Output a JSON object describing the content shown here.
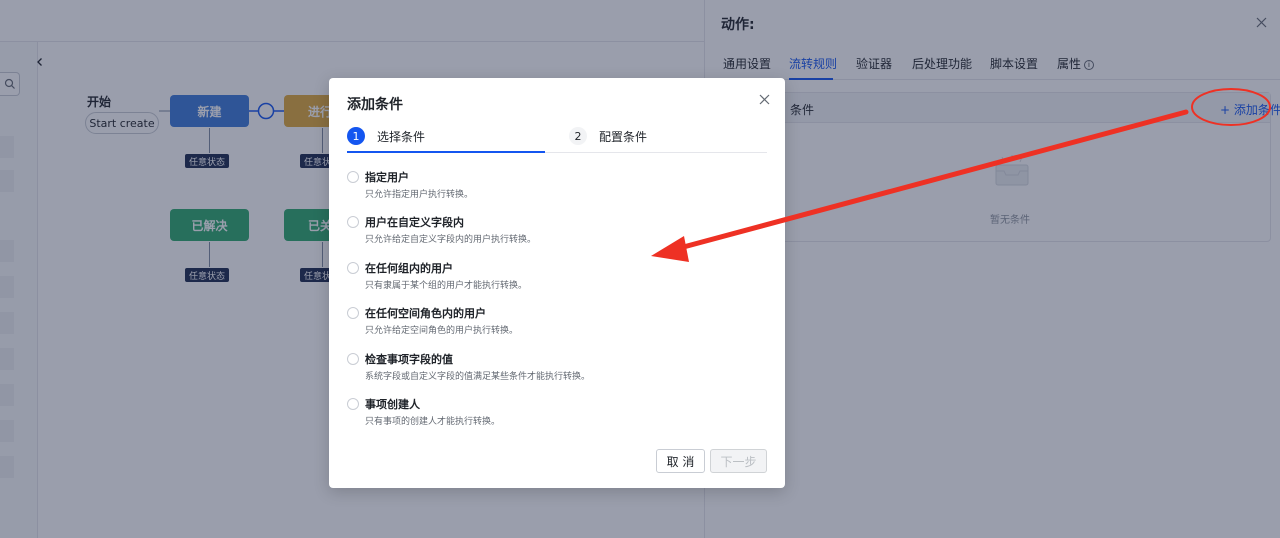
{
  "canvas": {
    "start_label": "开始",
    "start_pill": "Start create",
    "states": {
      "new": "新建",
      "in_progress": "进行",
      "resolved": "已解决",
      "closed": "已关"
    },
    "tags": {
      "any_state_1": "任意状态",
      "any_state_2": "任意状",
      "any_state_3": "任意状态",
      "any_state_4": "任意状"
    },
    "colors": {
      "blue": "#3d7bd9",
      "gold": "#e0a93b",
      "green": "#2eaa6e"
    }
  },
  "drawer": {
    "title": "动作:",
    "tabs": [
      "通用设置",
      "流转规则",
      "验证器",
      "后处理功能",
      "脚本设置",
      "属性"
    ],
    "active_tab": "流转规则",
    "condition_header": "条件",
    "add_condition": "添加条件",
    "empty_text": "暂无条件"
  },
  "modal": {
    "title": "添加条件",
    "steps": [
      {
        "num": "1",
        "label": "选择条件"
      },
      {
        "num": "2",
        "label": "配置条件"
      }
    ],
    "options": [
      {
        "title": "指定用户",
        "desc": "只允许指定用户执行转换。"
      },
      {
        "title": "用户在自定义字段内",
        "desc": "只允许给定自定义字段内的用户执行转换。"
      },
      {
        "title": "在任何组内的用户",
        "desc": "只有隶属于某个组的用户才能执行转换。"
      },
      {
        "title": "在任何空间角色内的用户",
        "desc": "只允许给定空间角色的用户执行转换。"
      },
      {
        "title": "检查事项字段的值",
        "desc": "系统字段或自定义字段的值满足某些条件才能执行转换。"
      },
      {
        "title": "事项创建人",
        "desc": "只有事项的创建人才能执行转换。"
      }
    ],
    "cancel_label": "取 消",
    "next_label": "下一步"
  },
  "annotation": {
    "color": "#ee3124"
  },
  "icons": [
    "search-icon",
    "chevron-left-icon",
    "close-icon",
    "info-icon",
    "plus-icon",
    "empty-box-icon",
    "arrow-icon"
  ]
}
